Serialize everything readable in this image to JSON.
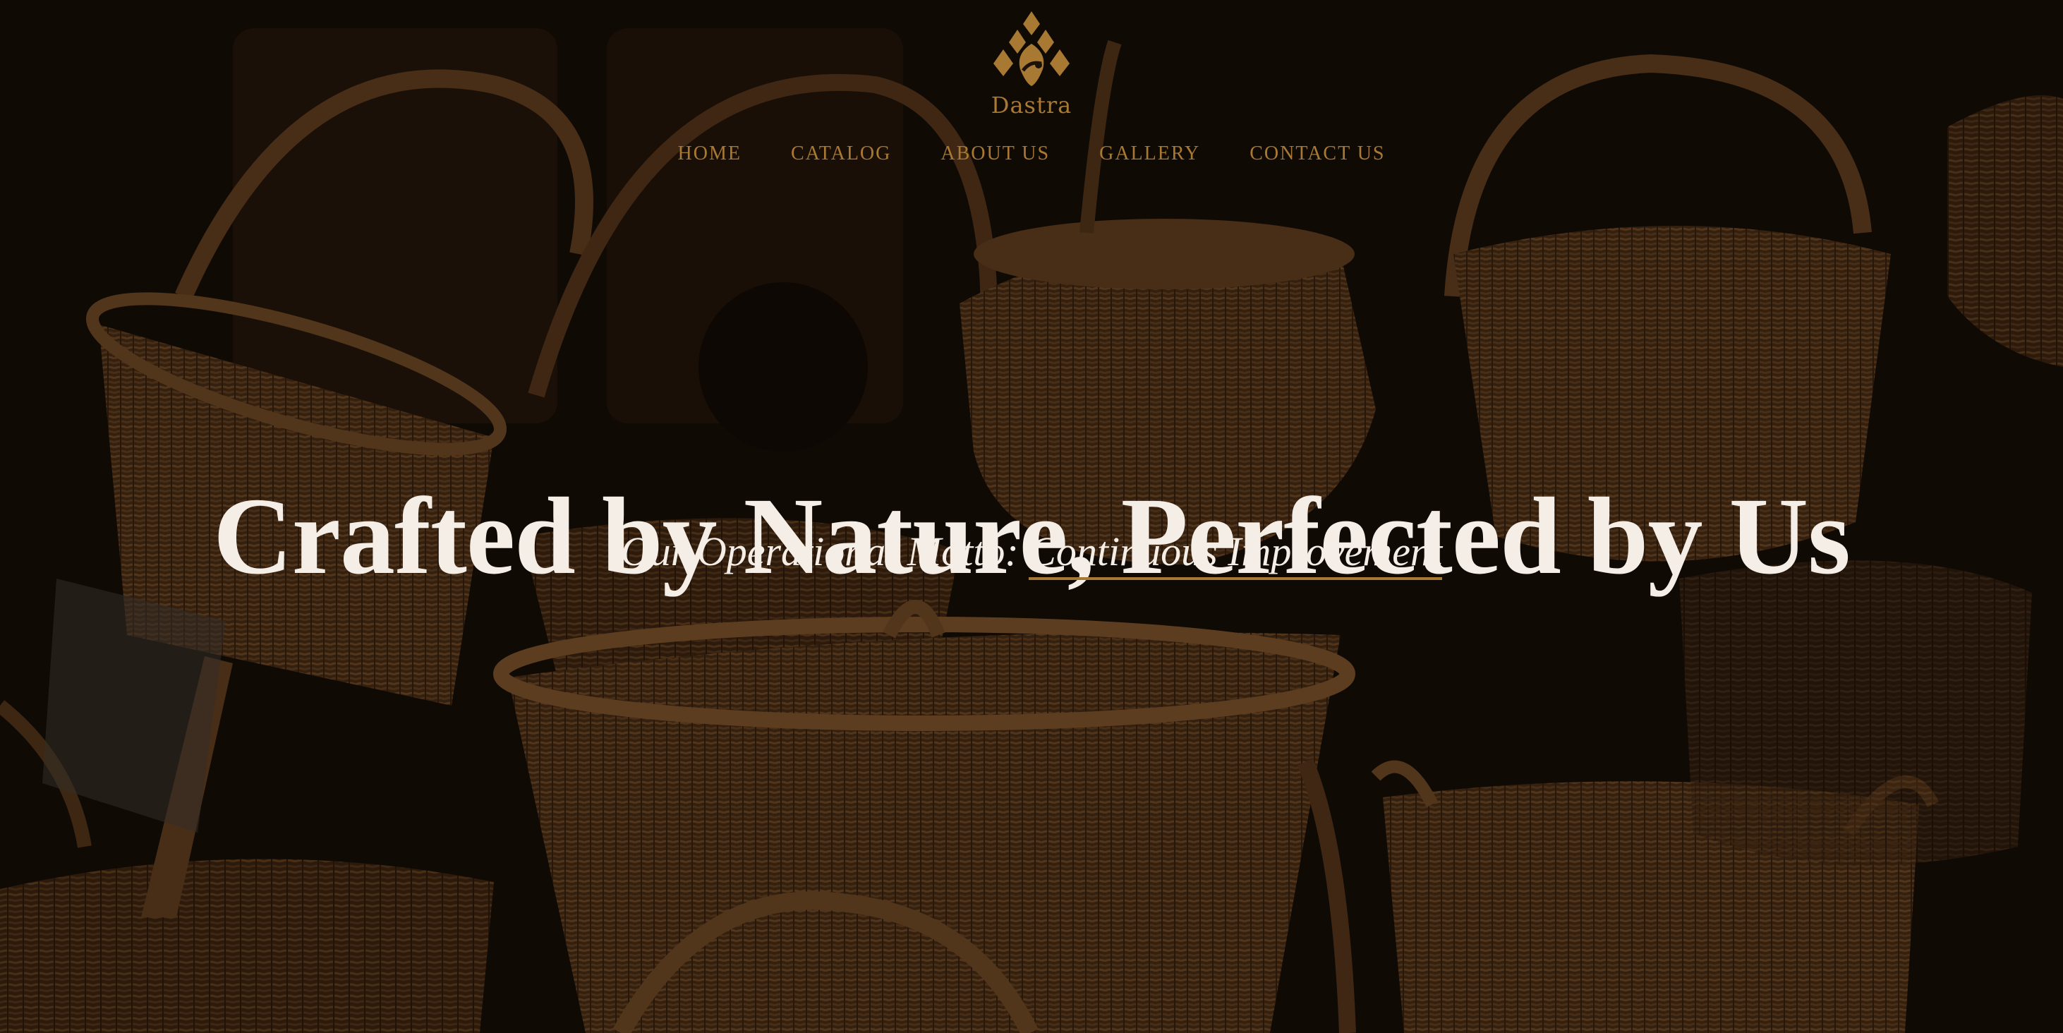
{
  "brand": {
    "name": "Dastra",
    "logo_icon": "basket-drop-logo-icon",
    "accent_color": "#a87932"
  },
  "nav": {
    "items": [
      {
        "label": "HOME"
      },
      {
        "label": "CATALOG"
      },
      {
        "label": "ABOUT US"
      },
      {
        "label": "GALLERY"
      },
      {
        "label": "CONTACT US"
      }
    ]
  },
  "hero": {
    "headline": "Crafted by Nature, Perfected by Us",
    "motto_prefix": "Our Operational Motto:",
    "motto_highlight": "Continuous Improvement",
    "background": "wicker-baskets-photo",
    "text_color": "#f4eee7"
  }
}
